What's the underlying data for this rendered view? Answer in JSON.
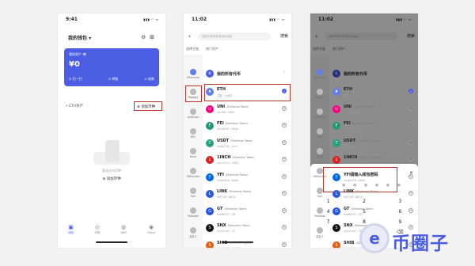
{
  "screen1": {
    "time": "9:41",
    "title": "我的钱包 ▾",
    "asset_label": "我的资产 👁",
    "asset_value": "¥0",
    "actions": [
      "扫一扫",
      "转账",
      "收款"
    ],
    "chain": "ETH资产",
    "add_token": "添加币种",
    "empty_text": "暂无任何币种",
    "empty_add": "添加币种",
    "tabs": [
      "钱包",
      "市场",
      "DeFi",
      "DApp"
    ]
  },
  "screen2": {
    "time": "11:02",
    "search_placeholder": "搜索币种名称或合约地址",
    "search_button": "搜索",
    "header_left": "选择主链",
    "header_right": "热门资产",
    "networks": [
      "Ethereum",
      "Polygon",
      "Arbitrum",
      "BSC",
      "Heco",
      "OKExchain",
      "Tron",
      "Polkadot",
      "自定义"
    ],
    "all_tokens": "我的所有代币",
    "tokens": [
      {
        "name": "ETH",
        "sub": "",
        "addr": "主链 · 以太坊",
        "color": "#627eea",
        "letter": "♦",
        "checked": true
      },
      {
        "name": "UNI",
        "sub": "(Ethereum Token)",
        "addr": "0x1f98...F984",
        "color": "#ff007a",
        "letter": "U",
        "checked": false
      },
      {
        "name": "FEI",
        "sub": "(Ethereum Token)",
        "addr": "0x956F47...FA5d",
        "color": "#22996e",
        "letter": "F",
        "checked": false
      },
      {
        "name": "USDT",
        "sub": "(Ethereum Token)",
        "addr": "0xdAC17F...1ec7",
        "color": "#26a17b",
        "letter": "T",
        "checked": false
      },
      {
        "name": "1INCH",
        "sub": "(Ethereum Token)",
        "addr": "0x111111...3302",
        "color": "#d82122",
        "letter": "1",
        "checked": false
      },
      {
        "name": "YFI",
        "sub": "(Ethereum Token)",
        "addr": "0x0bc529...6a9e",
        "color": "#006ae3",
        "letter": "Y",
        "checked": false
      },
      {
        "name": "LINK",
        "sub": "(Ethereum Token)",
        "addr": "0x5149...86CA",
        "color": "#2a5ada",
        "letter": "L",
        "checked": false
      },
      {
        "name": "GT",
        "sub": "(Ethereum Token)",
        "addr": "0xe66747...2D",
        "color": "#2354e6",
        "letter": "G",
        "checked": false
      },
      {
        "name": "SNX",
        "sub": "(Ethereum Token)",
        "addr": "0xC011a7...2F",
        "color": "#111",
        "letter": "S",
        "checked": false
      },
      {
        "name": "SHIB",
        "sub": "(Ethereum Token)",
        "addr": "0x95aD61...C4CE",
        "color": "#e15c12",
        "letter": "S",
        "checked": false
      }
    ]
  },
  "screen3": {
    "time": "11:02",
    "dialog_title": "请输入钱包密码",
    "close": "×",
    "dots": "● ● ● ● ● ●",
    "keys": [
      "1",
      "2",
      "3",
      "4",
      "5",
      "6",
      "7",
      "8",
      "9",
      "",
      "0",
      "⌫"
    ]
  },
  "watermark": "币圈子"
}
